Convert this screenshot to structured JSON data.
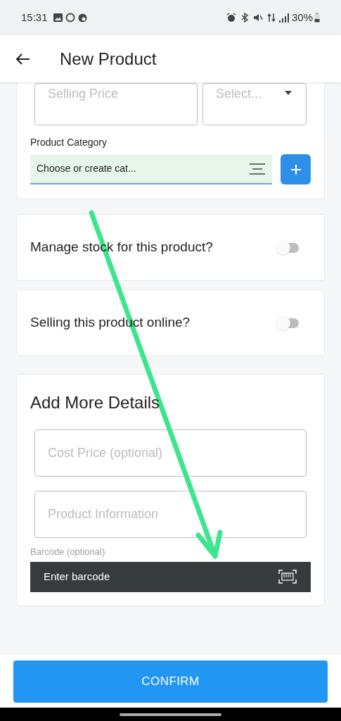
{
  "status_bar": {
    "time": "15:31",
    "battery": "30%"
  },
  "app_bar": {
    "title": "New Product"
  },
  "price_card": {
    "selling_price": {
      "placeholder": "Selling Price"
    },
    "unit_select": {
      "placeholder": "Select..."
    },
    "category": {
      "label": "Product Category",
      "placeholder": "Choose or create cat..."
    }
  },
  "toggles": [
    {
      "label": "Manage stock for this product?",
      "on": false
    },
    {
      "label": "Selling this product online?",
      "on": false
    }
  ],
  "details": {
    "title": "Add More Details",
    "fields": [
      {
        "placeholder": "Cost Price (optional)"
      },
      {
        "placeholder": "Product Information"
      }
    ],
    "barcode": {
      "label": "Barcode (optional)",
      "placeholder": "Enter barcode"
    }
  },
  "confirm_button": "CONFIRM"
}
